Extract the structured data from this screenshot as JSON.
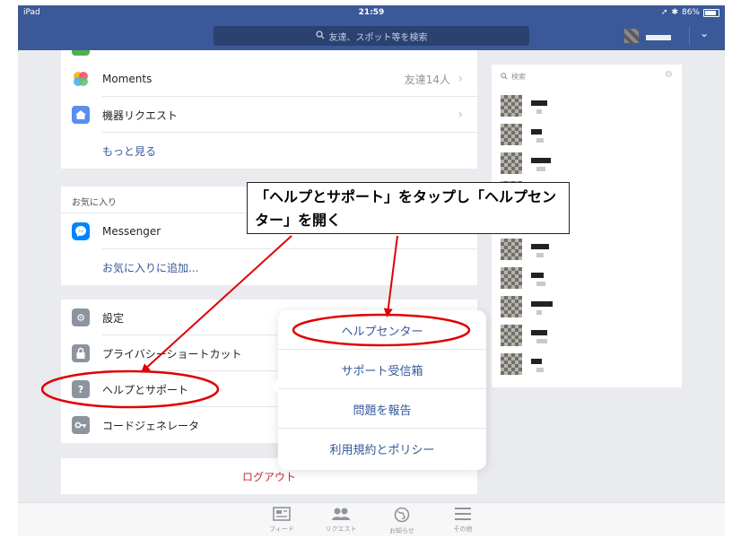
{
  "status_bar": {
    "device": "iPad",
    "time": "21:59",
    "battery": "86%",
    "battery_level": 0.86
  },
  "nav": {
    "search_placeholder": "友達、スポット等を検索"
  },
  "menu_top": [
    {
      "label": "Moments",
      "meta": "友達14人",
      "icon": "moments-icon"
    },
    {
      "label": "機器リクエスト",
      "meta": "",
      "icon": "house-device-icon"
    },
    {
      "label": "もっと見る",
      "meta": "",
      "icon": ""
    }
  ],
  "favorites": {
    "header": "お気に入り",
    "items": [
      {
        "label": "Messenger",
        "icon": "messenger-icon"
      },
      {
        "label": "お気に入りに追加...",
        "icon": ""
      }
    ]
  },
  "settings": [
    {
      "label": "設定",
      "icon": "gear-icon"
    },
    {
      "label": "プライバシーショートカット",
      "icon": "lock-icon"
    },
    {
      "label": "ヘルプとサポート",
      "icon": "question-icon"
    },
    {
      "label": "コードジェネレータ",
      "icon": "key-icon"
    }
  ],
  "logout_label": "ログアウト",
  "popover": [
    {
      "label": "ヘルプセンター"
    },
    {
      "label": "サポート受信箱"
    },
    {
      "label": "問題を報告"
    },
    {
      "label": "利用規約とポリシー"
    }
  ],
  "right_panel": {
    "search_placeholder": "検索"
  },
  "tabs": [
    {
      "label": "フィード",
      "icon": "feed-icon"
    },
    {
      "label": "リクエスト",
      "icon": "friends-icon"
    },
    {
      "label": "お知らせ",
      "icon": "globe-icon"
    },
    {
      "label": "その他",
      "icon": "menu-icon"
    }
  ],
  "annotation": {
    "line1": "「ヘルプとサポート」をタップし「ヘルプセン",
    "line2": "ター」を開く"
  },
  "colors": {
    "brand": "#3b5998",
    "link": "#365899",
    "logout": "#be2d2d",
    "annotation": "#e00000"
  }
}
